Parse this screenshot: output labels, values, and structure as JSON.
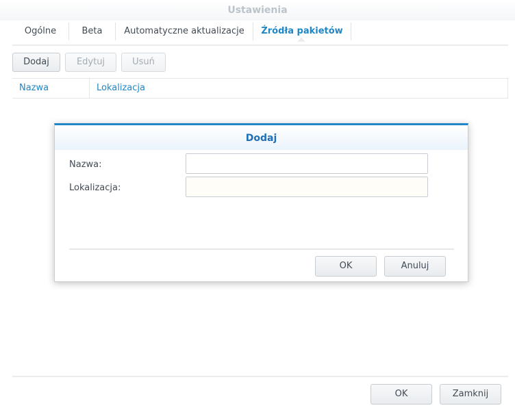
{
  "window": {
    "title": "Ustawienia"
  },
  "tabs": [
    {
      "label": "Ogólne"
    },
    {
      "label": "Beta"
    },
    {
      "label": "Automatyczne aktualizacje"
    },
    {
      "label": "Źródła pakietów",
      "active": true
    }
  ],
  "toolbar": {
    "add_label": "Dodaj",
    "edit_label": "Edytuj",
    "delete_label": "Usuń"
  },
  "grid": {
    "columns": [
      "Nazwa",
      "Lokalizacja"
    ],
    "rows": []
  },
  "dialog": {
    "title": "Dodaj",
    "name_label": "Nazwa:",
    "name_value": "",
    "location_label": "Lokalizacja:",
    "location_value": "",
    "ok_label": "OK",
    "cancel_label": "Anuluj"
  },
  "footer": {
    "ok_label": "OK",
    "close_label": "Zamknij"
  },
  "colors": {
    "accent": "#1f86c7",
    "text": "#414b55",
    "disabled_text": "#a3abb3"
  }
}
